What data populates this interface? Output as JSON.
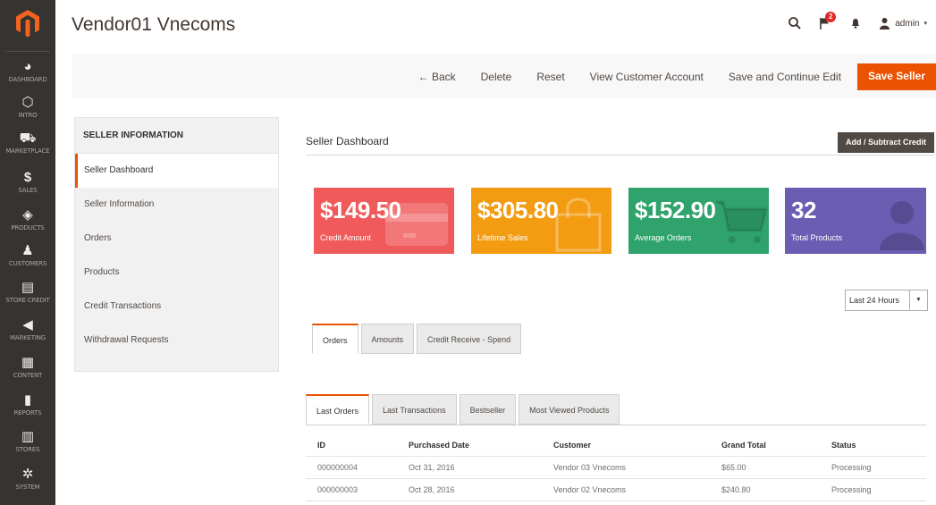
{
  "sidebar": {
    "items": [
      {
        "icon": "dashboard-icon",
        "label": "DASHBOARD"
      },
      {
        "icon": "hexagon-icon",
        "label": "INTRO"
      },
      {
        "icon": "cart-icon",
        "label": "MARKETPLACE"
      },
      {
        "icon": "dollar-icon",
        "label": "SALES"
      },
      {
        "icon": "box-icon",
        "label": "PRODUCTS"
      },
      {
        "icon": "person-icon",
        "label": "CUSTOMERS"
      },
      {
        "icon": "card-icon",
        "label": "STORE CREDIT"
      },
      {
        "icon": "megaphone-icon",
        "label": "MARKETING"
      },
      {
        "icon": "content-icon",
        "label": "CONTENT"
      },
      {
        "icon": "bar-chart-icon",
        "label": "REPORTS"
      },
      {
        "icon": "store-icon",
        "label": "STORES"
      },
      {
        "icon": "gear-icon",
        "label": "SYSTEM"
      }
    ]
  },
  "header": {
    "title": "Vendor01 Vnecoms",
    "notification_count": "2",
    "user": "admin"
  },
  "toolbar": {
    "back": "Back",
    "delete": "Delete",
    "reset": "Reset",
    "view_account": "View Customer Account",
    "save_continue": "Save and Continue Edit",
    "save_seller": "Save Seller"
  },
  "left_panel": {
    "title": "SELLER INFORMATION",
    "items": [
      "Seller Dashboard",
      "Seller Information",
      "Orders",
      "Products",
      "Credit Transactions",
      "Withdrawal Requests"
    ]
  },
  "dashboard": {
    "title": "Seller Dashboard",
    "credit_button": "Add / Subtract Credit",
    "cards": [
      {
        "value": "$149.50",
        "label": "Credit Amount",
        "color": "#f05a5b",
        "icon": "credit-card-icon"
      },
      {
        "value": "$305.80",
        "label": "Lifetime Sales",
        "color": "#f39c12",
        "icon": "shopping-bag-icon"
      },
      {
        "value": "$152.90",
        "label": "Average Orders",
        "color": "#2fa36b",
        "icon": "shopping-cart-icon"
      },
      {
        "value": "32",
        "label": "Total Products",
        "color": "#6b5db3",
        "icon": "user-silhouette-icon"
      }
    ],
    "range": "Last 24 Hours",
    "tabs1": [
      "Orders",
      "Amounts",
      "Credit Receive - Spend"
    ],
    "tabs2": [
      "Last Orders",
      "Last Transactions",
      "Bestseller",
      "Most Viewed Products"
    ]
  },
  "orders_table": {
    "headers": [
      "ID",
      "Purchased Date",
      "Customer",
      "Grand Total",
      "Status"
    ],
    "rows": [
      [
        "000000004",
        "Oct 31, 2016",
        "Vendor 03 Vnecoms",
        "$65.00",
        "Processing"
      ],
      [
        "000000003",
        "Oct 28, 2016",
        "Vendor 02 Vnecoms",
        "$240.80",
        "Processing"
      ]
    ]
  }
}
